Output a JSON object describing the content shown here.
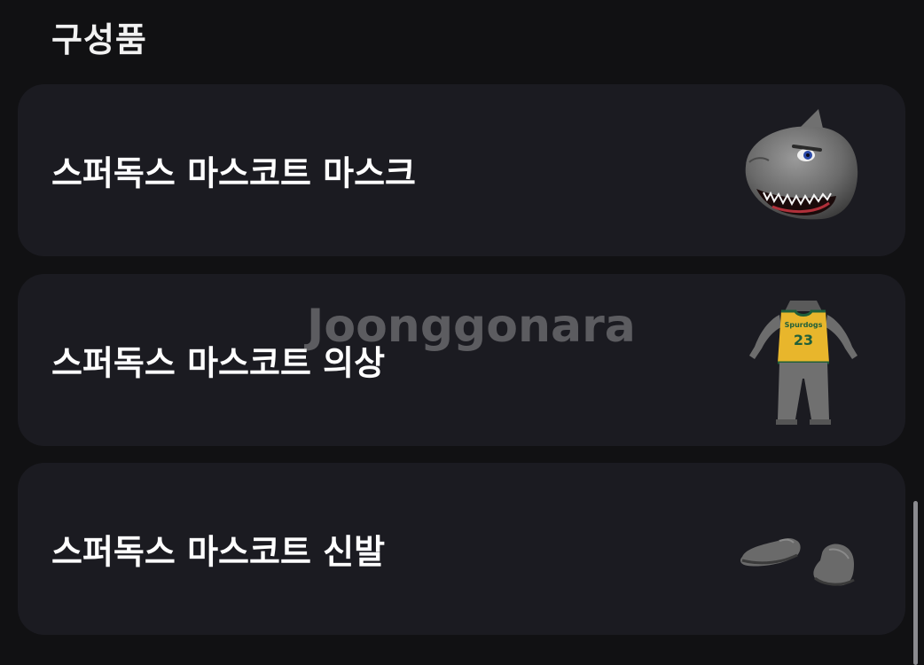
{
  "section": {
    "title": "구성품"
  },
  "items": [
    {
      "label": "스퍼독스 마스코트 마스크",
      "icon": "shark-mask-icon"
    },
    {
      "label": "스퍼독스 마스코트 의상",
      "icon": "mascot-costume-icon"
    },
    {
      "label": "스퍼독스 마스코트 신발",
      "icon": "mascot-shoes-icon"
    }
  ],
  "costume": {
    "jersey_number": "23"
  },
  "watermark": {
    "text": "Joonggonara"
  },
  "colors": {
    "background": "#111113",
    "card": "#1b1b21",
    "text": "#ffffff",
    "jersey": "#e8b62c",
    "jersey_trim": "#1f5f3a"
  }
}
